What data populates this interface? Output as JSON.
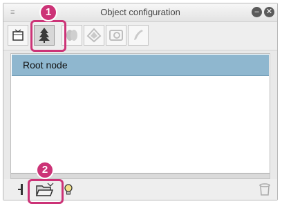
{
  "window": {
    "title": "Object configuration",
    "minimize_icon": "minimize-icon",
    "close_icon": "close-icon"
  },
  "toolbar": {
    "buttons": [
      {
        "name": "object-list-button",
        "icon": "object-list-icon"
      },
      {
        "name": "tree-button",
        "icon": "tree-icon",
        "selected": true
      },
      {
        "name": "foliage-button",
        "icon": "foliage-icon"
      },
      {
        "name": "layer-button",
        "icon": "layer-icon"
      },
      {
        "name": "texture-button",
        "icon": "texture-icon"
      },
      {
        "name": "edit-button",
        "icon": "pen-icon"
      }
    ]
  },
  "tree": {
    "items": [
      {
        "label": "Root node",
        "selected": true
      }
    ]
  },
  "bottom": {
    "icons": [
      "pin-icon",
      "folder-icon",
      "lightbulb-icon",
      "trash-icon"
    ]
  },
  "callouts": [
    {
      "label": "1"
    },
    {
      "label": "2"
    }
  ],
  "colors": {
    "accent": "#cc3377",
    "selection": "#8fb7cf"
  }
}
